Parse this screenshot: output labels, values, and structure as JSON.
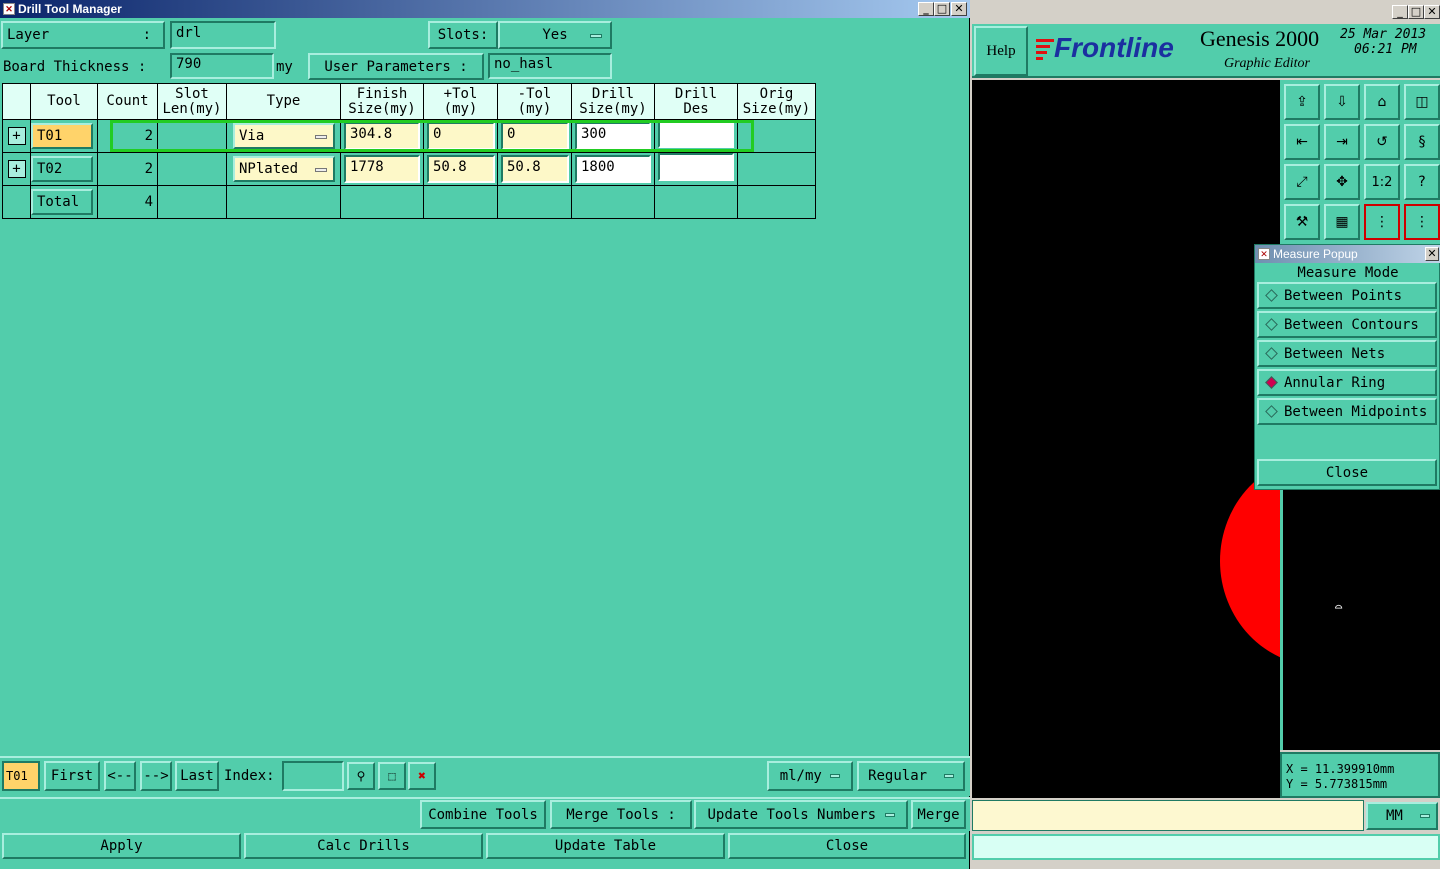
{
  "left_window": {
    "title": "Drill Tool Manager",
    "layer_label": "Layer",
    "layer_value": "drl",
    "slots_label": "Slots:",
    "slots_value": "Yes",
    "board_thickness_label": "Board Thickness :",
    "board_thickness_value": "790",
    "board_thickness_unit": "my",
    "user_params_label": "User Parameters :",
    "user_params_value": "no_hasl",
    "table": {
      "headers": [
        "Tool",
        "Count",
        "Slot\nLen(my)",
        "Type",
        "Finish\nSize(my)",
        "+Tol\n(my)",
        "-Tol\n(my)",
        "Drill\nSize(my)",
        "Drill\nDes",
        "Orig\nSize(my)"
      ],
      "rows": [
        {
          "tool": "T01",
          "count": "2",
          "type": "Via",
          "finish": "304.8",
          "ptol": "0",
          "mtol": "0",
          "drill": "300",
          "des": ""
        },
        {
          "tool": "T02",
          "count": "2",
          "type": "NPlated",
          "finish": "1778",
          "ptol": "50.8",
          "mtol": "50.8",
          "drill": "1800",
          "des": ""
        }
      ],
      "total_label": "Total",
      "total_count": "4"
    },
    "nav": {
      "current": "T01",
      "first": "First",
      "prev": "<--",
      "next": "-->",
      "last": "Last",
      "index_label": "Index:",
      "index_value": "",
      "units": "ml/my",
      "mode": "Regular"
    },
    "actions": {
      "combine": "Combine Tools",
      "merge_label": "Merge Tools :",
      "update_numbers": "Update Tools Numbers",
      "merge": "Merge",
      "apply": "Apply",
      "calc": "Calc Drills",
      "update_table": "Update Table",
      "close": "Close"
    }
  },
  "right_window": {
    "help": "Help",
    "brand": "Frontline",
    "product": "Genesis 2000",
    "subtitle": "Graphic Editor",
    "date": "25 Mar 2013",
    "time": "06:21 PM",
    "measure_popup": {
      "title": "Measure Popup",
      "mode_label": "Measure Mode",
      "options": [
        "Between Points",
        "Between Contours",
        "Between Nets",
        "Annular Ring",
        "Between Midpoints"
      ],
      "selected": "Annular Ring",
      "close": "Close"
    },
    "coords": {
      "x": "X = 11.399910mm",
      "y": "Y = 5.773815mm"
    },
    "units": "MM",
    "colors": {
      "feature": "#ff0000",
      "canvas": "#000000",
      "highlight": "#22cc22"
    }
  }
}
